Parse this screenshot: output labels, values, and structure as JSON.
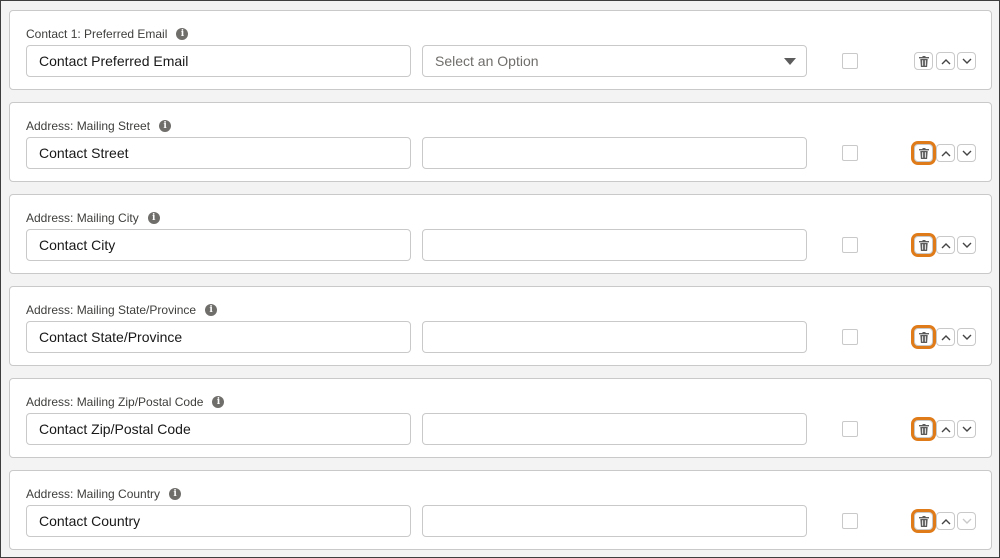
{
  "rows": [
    {
      "label": "Contact 1: Preferred Email",
      "field_value": "Contact Preferred Email",
      "mapping_value": "",
      "mapping_placeholder": "Select an Option",
      "has_dropdown": true,
      "delete_highlighted": false,
      "down_enabled": true,
      "checked": false
    },
    {
      "label": "Address: Mailing Street",
      "field_value": "Contact Street",
      "mapping_value": "",
      "mapping_placeholder": "",
      "has_dropdown": false,
      "delete_highlighted": true,
      "down_enabled": true,
      "checked": false
    },
    {
      "label": "Address: Mailing City",
      "field_value": "Contact City",
      "mapping_value": "",
      "mapping_placeholder": "",
      "has_dropdown": false,
      "delete_highlighted": true,
      "down_enabled": true,
      "checked": false
    },
    {
      "label": "Address: Mailing State/Province",
      "field_value": "Contact State/Province",
      "mapping_value": "",
      "mapping_placeholder": "",
      "has_dropdown": false,
      "delete_highlighted": true,
      "down_enabled": true,
      "checked": false
    },
    {
      "label": "Address: Mailing Zip/Postal Code",
      "field_value": "Contact Zip/Postal Code",
      "mapping_value": "",
      "mapping_placeholder": "",
      "has_dropdown": false,
      "delete_highlighted": true,
      "down_enabled": true,
      "checked": false
    },
    {
      "label": "Address: Mailing Country",
      "field_value": "Contact Country",
      "mapping_value": "",
      "mapping_placeholder": "",
      "has_dropdown": false,
      "delete_highlighted": true,
      "down_enabled": false,
      "checked": false
    }
  ],
  "icons": {
    "info": "info-icon",
    "delete": "trash-icon",
    "up": "chevron-up-icon",
    "down": "chevron-down-icon",
    "dropdown": "caret-down-icon"
  },
  "colors": {
    "highlight": "#e07b19",
    "border": "#c9c9c9",
    "page_bg": "#f3f3f3"
  }
}
